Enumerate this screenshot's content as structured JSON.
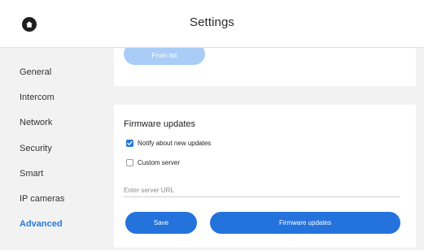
{
  "header": {
    "title": "Settings",
    "home_icon": "home-icon"
  },
  "sidebar": {
    "items": [
      {
        "label": "General",
        "active": false
      },
      {
        "label": "Intercom",
        "active": false
      },
      {
        "label": "Network",
        "active": false
      },
      {
        "label": "Security",
        "active": false
      },
      {
        "label": "Smart",
        "active": false
      },
      {
        "label": "IP cameras",
        "active": false
      },
      {
        "label": "Advanced",
        "active": true
      }
    ]
  },
  "top_card": {
    "from_list_label": "From list"
  },
  "firmware": {
    "title": "Firmware updates",
    "notify_label": "Notify about new updates",
    "notify_checked": true,
    "custom_server_label": "Custom server",
    "custom_server_checked": false,
    "server_url": {
      "value": "",
      "placeholder": "Enter server URL"
    },
    "save_label": "Save",
    "update_label": "Firmware updates"
  },
  "colors": {
    "accent": "#2979d8",
    "button": "#2472dc",
    "button_disabled": "#a9cdf6",
    "background": "#f2f2f2",
    "card": "#ffffff"
  }
}
